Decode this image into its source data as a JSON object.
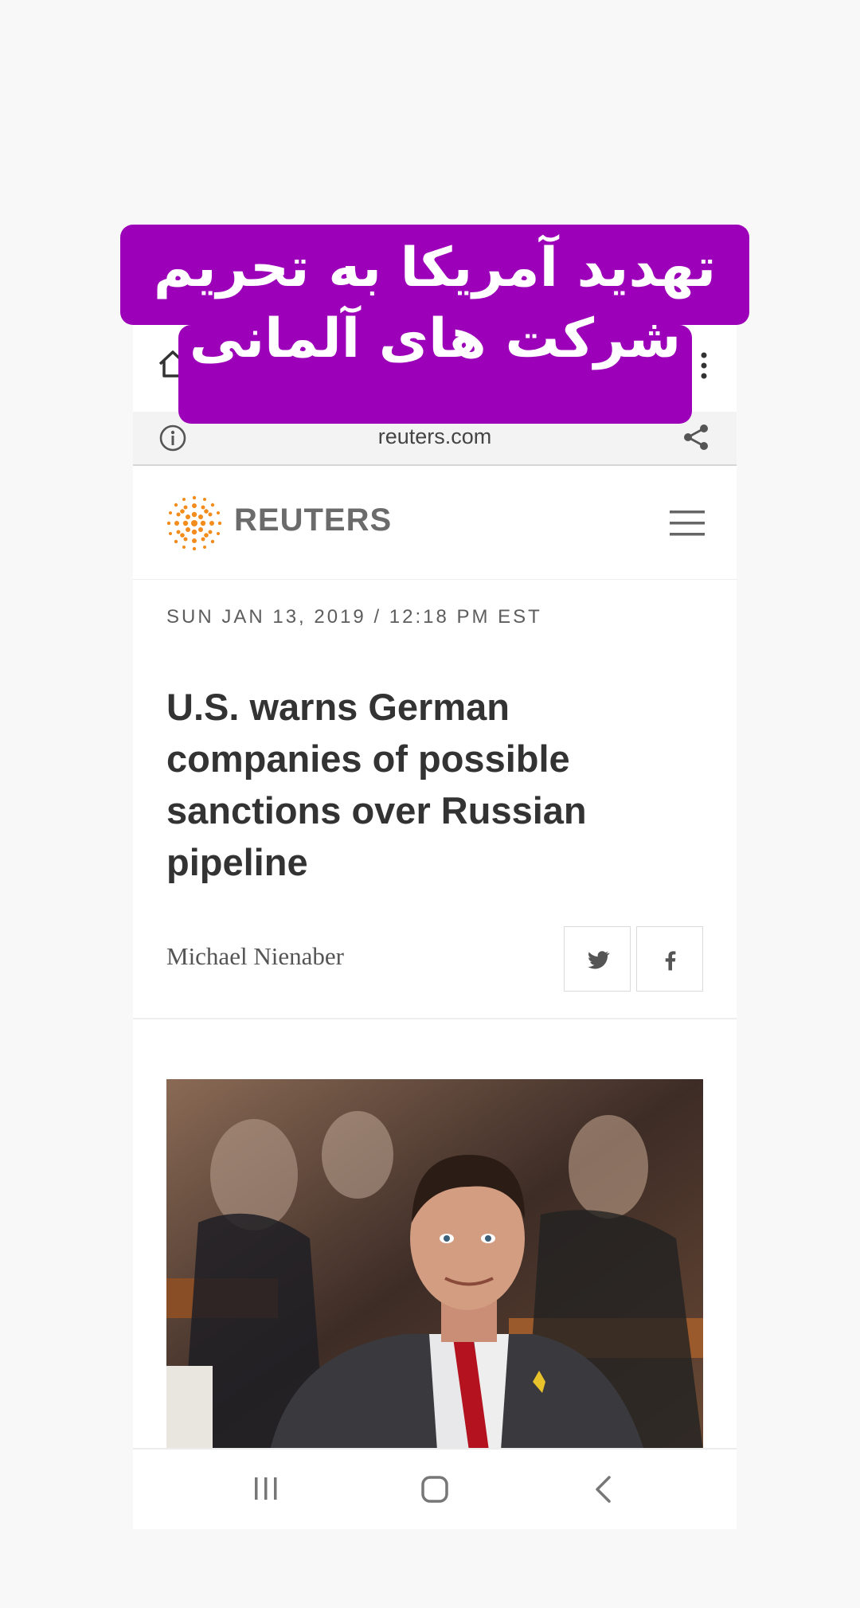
{
  "overlay": {
    "line1": "تهدید آمریکا به تحریم",
    "line2": "شرکت های آلمانی",
    "color": "#9c00b8"
  },
  "browser": {
    "url": "reuters.com",
    "icons": [
      "home-icon",
      "menu-dots-icon",
      "info-icon",
      "share-icon"
    ]
  },
  "site": {
    "brand": "REUTERS",
    "brand_color": "#f28c1c",
    "menu_icon": "hamburger-icon"
  },
  "article": {
    "dateline": "SUN JAN 13, 2019 / 12:18 PM EST",
    "headline": "U.S. warns German companies of possible sanctions over Russian pipeline",
    "author": "Michael Nienaber",
    "share_buttons": [
      "twitter-icon",
      "facebook-icon"
    ]
  },
  "nav_bar": {
    "icons": [
      "recents-icon",
      "home-button-icon",
      "back-icon"
    ]
  }
}
